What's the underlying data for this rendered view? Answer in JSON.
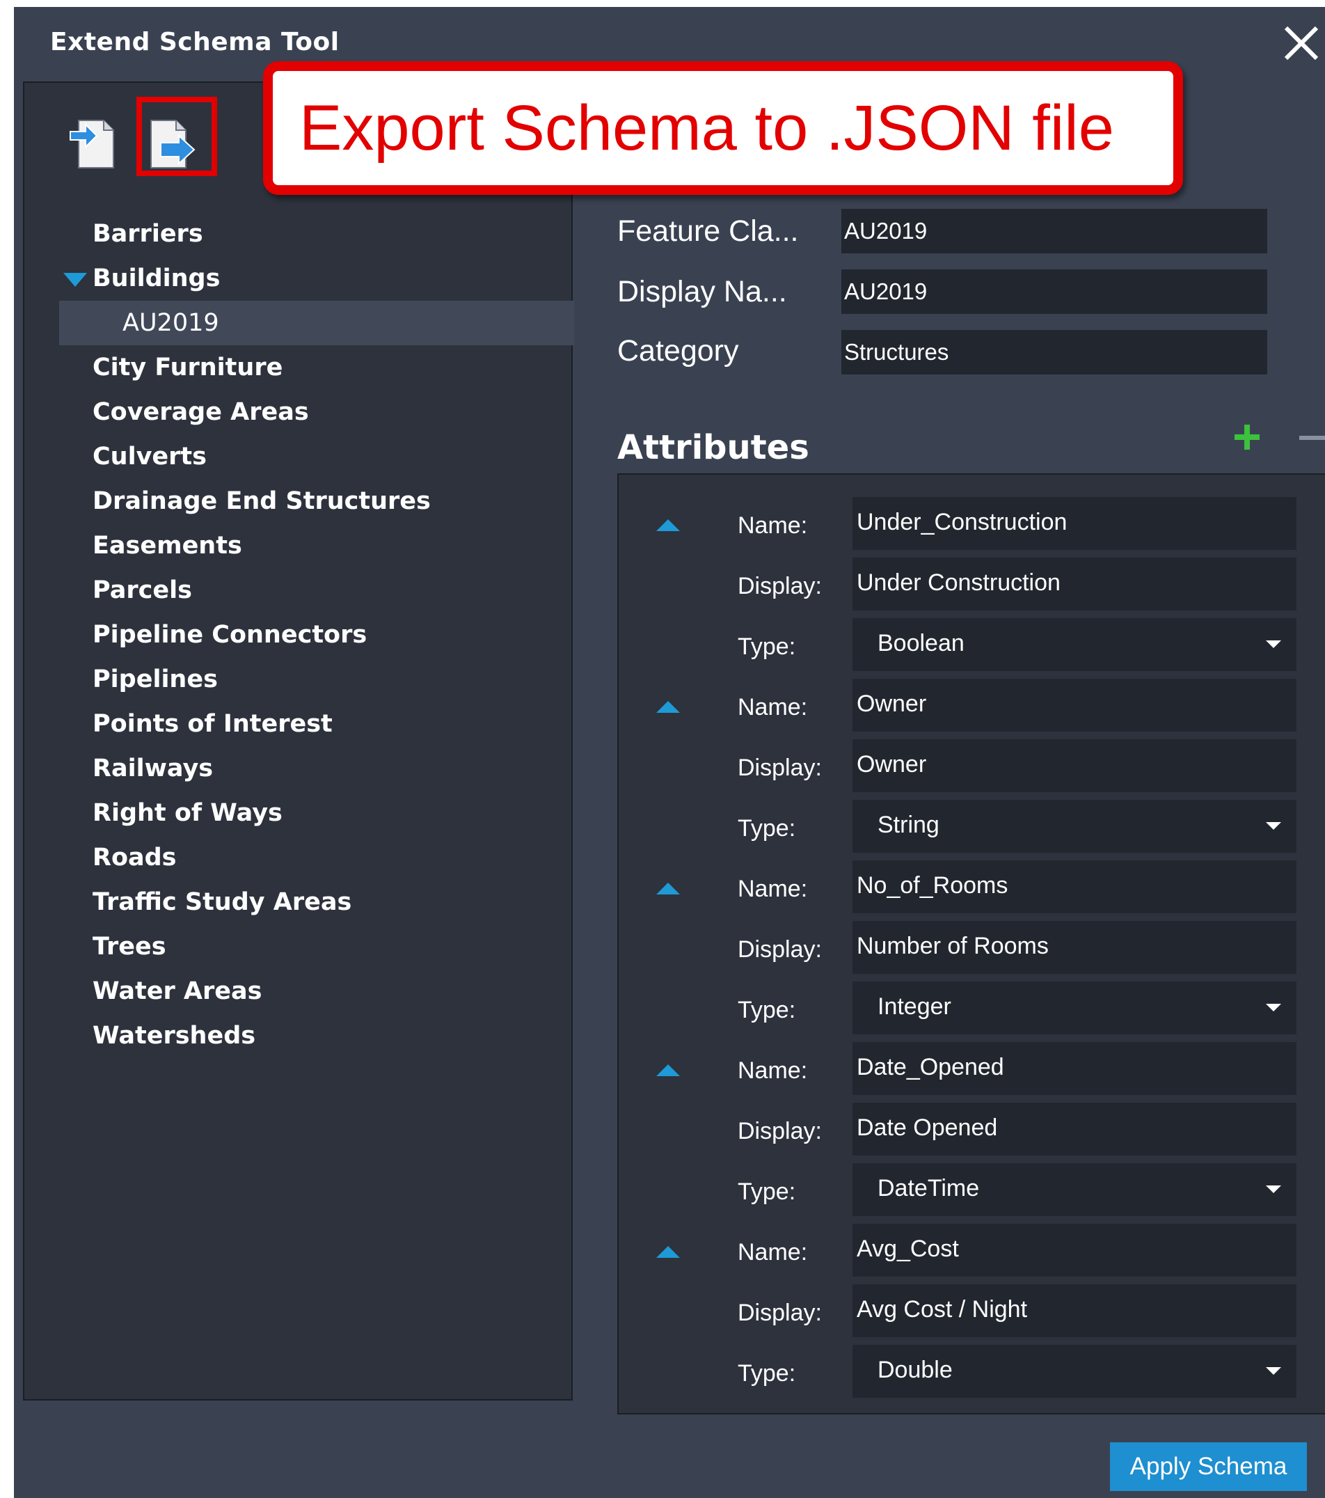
{
  "window": {
    "title": "Extend Schema Tool"
  },
  "callout": {
    "text": "Export Schema to .JSON file"
  },
  "toolbar": {
    "import_icon": "import-file-icon",
    "export_icon": "export-file-icon"
  },
  "tree": {
    "items": [
      {
        "label": "Barriers"
      },
      {
        "label": "Buildings",
        "expanded": true
      },
      {
        "label": "AU2019",
        "child": true,
        "selected": true
      },
      {
        "label": "City Furniture"
      },
      {
        "label": "Coverage Areas"
      },
      {
        "label": "Culverts"
      },
      {
        "label": "Drainage End Structures"
      },
      {
        "label": "Easements"
      },
      {
        "label": "Parcels"
      },
      {
        "label": "Pipeline Connectors"
      },
      {
        "label": "Pipelines"
      },
      {
        "label": "Points of Interest"
      },
      {
        "label": "Railways"
      },
      {
        "label": "Right of Ways"
      },
      {
        "label": "Roads"
      },
      {
        "label": "Traffic Study Areas"
      },
      {
        "label": "Trees"
      },
      {
        "label": "Water Areas"
      },
      {
        "label": "Watersheds"
      }
    ]
  },
  "properties": {
    "feature_class_label": "Feature Cla...",
    "feature_class_value": "AU2019",
    "display_name_label": "Display Na...",
    "display_name_value": "AU2019",
    "category_label": "Category",
    "category_value": "Structures"
  },
  "attributes": {
    "title": "Attributes",
    "name_label": "Name:",
    "display_label": "Display:",
    "type_label": "Type:",
    "items": [
      {
        "name": "Under_Construction",
        "display": "Under Construction",
        "type": "Boolean"
      },
      {
        "name": "Owner",
        "display": "Owner",
        "type": "String"
      },
      {
        "name": "No_of_Rooms",
        "display": "Number of Rooms",
        "type": "Integer"
      },
      {
        "name": "Date_Opened",
        "display": "Date Opened",
        "type": "DateTime"
      },
      {
        "name": "Avg_Cost",
        "display": "Avg Cost / Night",
        "type": "Double"
      }
    ]
  },
  "actions": {
    "apply_label": "Apply Schema"
  },
  "colors": {
    "accent": "#1e9ad6",
    "highlight": "#e20000",
    "add": "#3cc23c",
    "panel": "#2d323d",
    "window": "#3a4252"
  }
}
